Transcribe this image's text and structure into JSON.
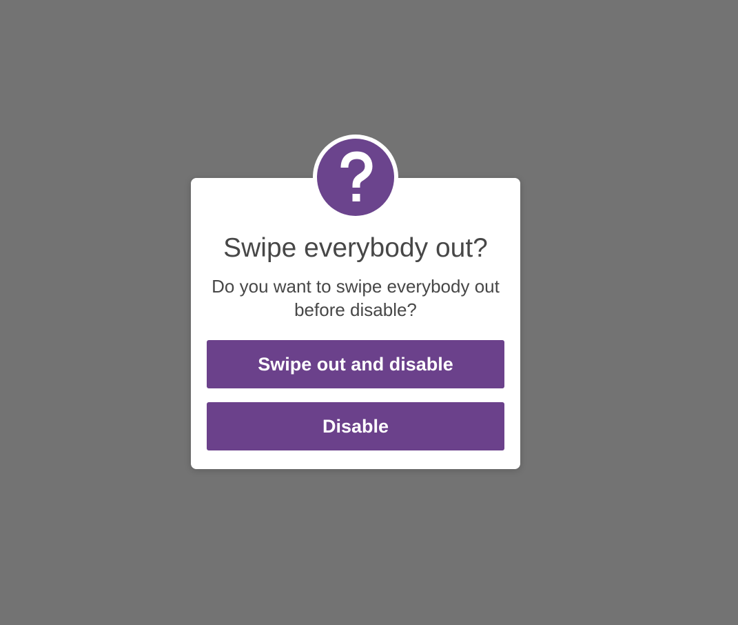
{
  "dialog": {
    "title": "Swipe everybody out?",
    "message": "Do you want to swipe everybody out before disable?",
    "icon": "question-mark-icon",
    "primary_button": "Swipe out and disable",
    "secondary_button": "Disable"
  },
  "colors": {
    "accent": "#6b418b",
    "overlay": "#737373",
    "dialog_background": "#ffffff",
    "text": "#474747"
  }
}
